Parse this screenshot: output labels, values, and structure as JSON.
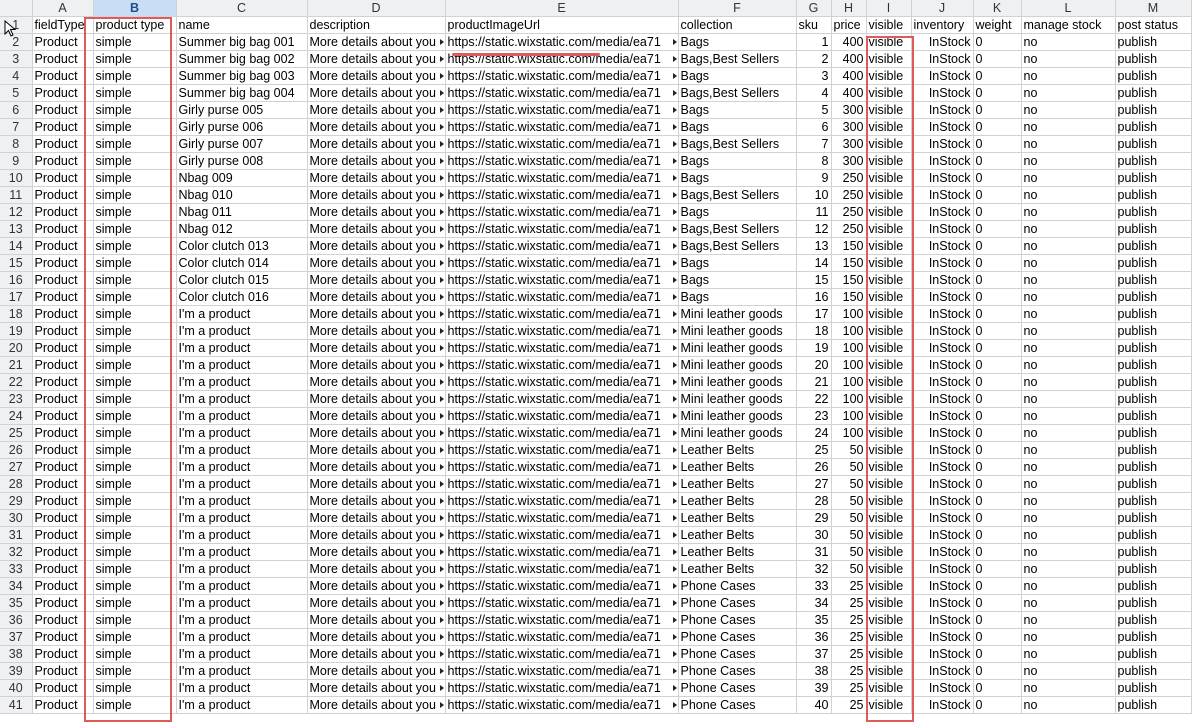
{
  "columns": [
    "",
    "A",
    "B",
    "C",
    "D",
    "E",
    "F",
    "G",
    "H",
    "I",
    "J",
    "K",
    "L",
    "M"
  ],
  "selected_column": "B",
  "header_row": {
    "row": "1",
    "cells": [
      "fieldType",
      "product type",
      "name",
      "description",
      "productImageUrl",
      "collection",
      "sku",
      "price",
      "visible",
      "inventory",
      "weight",
      "manage stock",
      "post status"
    ]
  },
  "rows": [
    {
      "n": "2",
      "cells": [
        "Product",
        "simple",
        "Summer big bag 001",
        "More details about you",
        "https://static.wixstatic.com/media/ea71",
        "Bags",
        "1",
        "400",
        "visible",
        "InStock",
        "0",
        "no",
        "publish"
      ]
    },
    {
      "n": "3",
      "cells": [
        "Product",
        "simple",
        "Summer big bag 002",
        "More details about you",
        "https://static.wixstatic.com/media/ea71",
        "Bags,Best Sellers",
        "2",
        "400",
        "visible",
        "InStock",
        "0",
        "no",
        "publish"
      ]
    },
    {
      "n": "4",
      "cells": [
        "Product",
        "simple",
        "Summer big bag 003",
        "More details about you",
        "https://static.wixstatic.com/media/ea71",
        "Bags",
        "3",
        "400",
        "visible",
        "InStock",
        "0",
        "no",
        "publish"
      ]
    },
    {
      "n": "5",
      "cells": [
        "Product",
        "simple",
        "Summer big bag 004",
        "More details about you",
        "https://static.wixstatic.com/media/ea71",
        "Bags,Best Sellers",
        "4",
        "400",
        "visible",
        "InStock",
        "0",
        "no",
        "publish"
      ]
    },
    {
      "n": "6",
      "cells": [
        "Product",
        "simple",
        "Girly purse 005",
        "More details about you",
        "https://static.wixstatic.com/media/ea71",
        "Bags",
        "5",
        "300",
        "visible",
        "InStock",
        "0",
        "no",
        "publish"
      ]
    },
    {
      "n": "7",
      "cells": [
        "Product",
        "simple",
        "Girly purse 006",
        "More details about you",
        "https://static.wixstatic.com/media/ea71",
        "Bags",
        "6",
        "300",
        "visible",
        "InStock",
        "0",
        "no",
        "publish"
      ]
    },
    {
      "n": "8",
      "cells": [
        "Product",
        "simple",
        "Girly purse 007",
        "More details about you",
        "https://static.wixstatic.com/media/ea71",
        "Bags,Best Sellers",
        "7",
        "300",
        "visible",
        "InStock",
        "0",
        "no",
        "publish"
      ]
    },
    {
      "n": "9",
      "cells": [
        "Product",
        "simple",
        "Girly purse 008",
        "More details about you",
        "https://static.wixstatic.com/media/ea71",
        "Bags",
        "8",
        "300",
        "visible",
        "InStock",
        "0",
        "no",
        "publish"
      ]
    },
    {
      "n": "10",
      "cells": [
        "Product",
        "simple",
        "Nbag 009",
        "More details about you",
        "https://static.wixstatic.com/media/ea71",
        "Bags",
        "9",
        "250",
        "visible",
        "InStock",
        "0",
        "no",
        "publish"
      ]
    },
    {
      "n": "11",
      "cells": [
        "Product",
        "simple",
        "Nbag 010",
        "More details about you",
        "https://static.wixstatic.com/media/ea71",
        "Bags,Best Sellers",
        "10",
        "250",
        "visible",
        "InStock",
        "0",
        "no",
        "publish"
      ]
    },
    {
      "n": "12",
      "cells": [
        "Product",
        "simple",
        "Nbag 011",
        "More details about you",
        "https://static.wixstatic.com/media/ea71",
        "Bags",
        "11",
        "250",
        "visible",
        "InStock",
        "0",
        "no",
        "publish"
      ]
    },
    {
      "n": "13",
      "cells": [
        "Product",
        "simple",
        "Nbag 012",
        "More details about you",
        "https://static.wixstatic.com/media/ea71",
        "Bags,Best Sellers",
        "12",
        "250",
        "visible",
        "InStock",
        "0",
        "no",
        "publish"
      ]
    },
    {
      "n": "14",
      "cells": [
        "Product",
        "simple",
        "Color clutch 013",
        "More details about you",
        "https://static.wixstatic.com/media/ea71",
        "Bags,Best Sellers",
        "13",
        "150",
        "visible",
        "InStock",
        "0",
        "no",
        "publish"
      ]
    },
    {
      "n": "15",
      "cells": [
        "Product",
        "simple",
        "Color clutch 014",
        "More details about you",
        "https://static.wixstatic.com/media/ea71",
        "Bags",
        "14",
        "150",
        "visible",
        "InStock",
        "0",
        "no",
        "publish"
      ]
    },
    {
      "n": "16",
      "cells": [
        "Product",
        "simple",
        "Color clutch 015",
        "More details about you",
        "https://static.wixstatic.com/media/ea71",
        "Bags",
        "15",
        "150",
        "visible",
        "InStock",
        "0",
        "no",
        "publish"
      ]
    },
    {
      "n": "17",
      "cells": [
        "Product",
        "simple",
        "Color clutch 016",
        "More details about you",
        "https://static.wixstatic.com/media/ea71",
        "Bags",
        "16",
        "150",
        "visible",
        "InStock",
        "0",
        "no",
        "publish"
      ]
    },
    {
      "n": "18",
      "cells": [
        "Product",
        "simple",
        "I'm a product",
        "More details about you",
        "https://static.wixstatic.com/media/ea71",
        "Mini leather goods",
        "17",
        "100",
        "visible",
        "InStock",
        "0",
        "no",
        "publish"
      ]
    },
    {
      "n": "19",
      "cells": [
        "Product",
        "simple",
        "I'm a product",
        "More details about you",
        "https://static.wixstatic.com/media/ea71",
        "Mini leather goods",
        "18",
        "100",
        "visible",
        "InStock",
        "0",
        "no",
        "publish"
      ]
    },
    {
      "n": "20",
      "cells": [
        "Product",
        "simple",
        "I'm a product",
        "More details about you",
        "https://static.wixstatic.com/media/ea71",
        "Mini leather goods",
        "19",
        "100",
        "visible",
        "InStock",
        "0",
        "no",
        "publish"
      ]
    },
    {
      "n": "21",
      "cells": [
        "Product",
        "simple",
        "I'm a product",
        "More details about you",
        "https://static.wixstatic.com/media/ea71",
        "Mini leather goods",
        "20",
        "100",
        "visible",
        "InStock",
        "0",
        "no",
        "publish"
      ]
    },
    {
      "n": "22",
      "cells": [
        "Product",
        "simple",
        "I'm a product",
        "More details about you",
        "https://static.wixstatic.com/media/ea71",
        "Mini leather goods",
        "21",
        "100",
        "visible",
        "InStock",
        "0",
        "no",
        "publish"
      ]
    },
    {
      "n": "23",
      "cells": [
        "Product",
        "simple",
        "I'm a product",
        "More details about you",
        "https://static.wixstatic.com/media/ea71",
        "Mini leather goods",
        "22",
        "100",
        "visible",
        "InStock",
        "0",
        "no",
        "publish"
      ]
    },
    {
      "n": "24",
      "cells": [
        "Product",
        "simple",
        "I'm a product",
        "More details about you",
        "https://static.wixstatic.com/media/ea71",
        "Mini leather goods",
        "23",
        "100",
        "visible",
        "InStock",
        "0",
        "no",
        "publish"
      ]
    },
    {
      "n": "25",
      "cells": [
        "Product",
        "simple",
        "I'm a product",
        "More details about you",
        "https://static.wixstatic.com/media/ea71",
        "Mini leather goods",
        "24",
        "100",
        "visible",
        "InStock",
        "0",
        "no",
        "publish"
      ]
    },
    {
      "n": "26",
      "cells": [
        "Product",
        "simple",
        "I'm a product",
        "More details about you",
        "https://static.wixstatic.com/media/ea71",
        "Leather Belts",
        "25",
        "50",
        "visible",
        "InStock",
        "0",
        "no",
        "publish"
      ]
    },
    {
      "n": "27",
      "cells": [
        "Product",
        "simple",
        "I'm a product",
        "More details about you",
        "https://static.wixstatic.com/media/ea71",
        "Leather Belts",
        "26",
        "50",
        "visible",
        "InStock",
        "0",
        "no",
        "publish"
      ]
    },
    {
      "n": "28",
      "cells": [
        "Product",
        "simple",
        "I'm a product",
        "More details about you",
        "https://static.wixstatic.com/media/ea71",
        "Leather Belts",
        "27",
        "50",
        "visible",
        "InStock",
        "0",
        "no",
        "publish"
      ]
    },
    {
      "n": "29",
      "cells": [
        "Product",
        "simple",
        "I'm a product",
        "More details about you",
        "https://static.wixstatic.com/media/ea71",
        "Leather Belts",
        "28",
        "50",
        "visible",
        "InStock",
        "0",
        "no",
        "publish"
      ]
    },
    {
      "n": "30",
      "cells": [
        "Product",
        "simple",
        "I'm a product",
        "More details about you",
        "https://static.wixstatic.com/media/ea71",
        "Leather Belts",
        "29",
        "50",
        "visible",
        "InStock",
        "0",
        "no",
        "publish"
      ]
    },
    {
      "n": "31",
      "cells": [
        "Product",
        "simple",
        "I'm a product",
        "More details about you",
        "https://static.wixstatic.com/media/ea71",
        "Leather Belts",
        "30",
        "50",
        "visible",
        "InStock",
        "0",
        "no",
        "publish"
      ]
    },
    {
      "n": "32",
      "cells": [
        "Product",
        "simple",
        "I'm a product",
        "More details about you",
        "https://static.wixstatic.com/media/ea71",
        "Leather Belts",
        "31",
        "50",
        "visible",
        "InStock",
        "0",
        "no",
        "publish"
      ]
    },
    {
      "n": "33",
      "cells": [
        "Product",
        "simple",
        "I'm a product",
        "More details about you",
        "https://static.wixstatic.com/media/ea71",
        "Leather Belts",
        "32",
        "50",
        "visible",
        "InStock",
        "0",
        "no",
        "publish"
      ]
    },
    {
      "n": "34",
      "cells": [
        "Product",
        "simple",
        "I'm a product",
        "More details about you",
        "https://static.wixstatic.com/media/ea71",
        "Phone Cases",
        "33",
        "25",
        "visible",
        "InStock",
        "0",
        "no",
        "publish"
      ]
    },
    {
      "n": "35",
      "cells": [
        "Product",
        "simple",
        "I'm a product",
        "More details about you",
        "https://static.wixstatic.com/media/ea71",
        "Phone Cases",
        "34",
        "25",
        "visible",
        "InStock",
        "0",
        "no",
        "publish"
      ]
    },
    {
      "n": "36",
      "cells": [
        "Product",
        "simple",
        "I'm a product",
        "More details about you",
        "https://static.wixstatic.com/media/ea71",
        "Phone Cases",
        "35",
        "25",
        "visible",
        "InStock",
        "0",
        "no",
        "publish"
      ]
    },
    {
      "n": "37",
      "cells": [
        "Product",
        "simple",
        "I'm a product",
        "More details about you",
        "https://static.wixstatic.com/media/ea71",
        "Phone Cases",
        "36",
        "25",
        "visible",
        "InStock",
        "0",
        "no",
        "publish"
      ]
    },
    {
      "n": "38",
      "cells": [
        "Product",
        "simple",
        "I'm a product",
        "More details about you",
        "https://static.wixstatic.com/media/ea71",
        "Phone Cases",
        "37",
        "25",
        "visible",
        "InStock",
        "0",
        "no",
        "publish"
      ]
    },
    {
      "n": "39",
      "cells": [
        "Product",
        "simple",
        "I'm a product",
        "More details about you",
        "https://static.wixstatic.com/media/ea71",
        "Phone Cases",
        "38",
        "25",
        "visible",
        "InStock",
        "0",
        "no",
        "publish"
      ]
    },
    {
      "n": "40",
      "cells": [
        "Product",
        "simple",
        "I'm a product",
        "More details about you",
        "https://static.wixstatic.com/media/ea71",
        "Phone Cases",
        "39",
        "25",
        "visible",
        "InStock",
        "0",
        "no",
        "publish"
      ]
    },
    {
      "n": "41",
      "cells": [
        "Product",
        "simple",
        "I'm a product",
        "More details about you",
        "https://static.wixstatic.com/media/ea71",
        "Phone Cases",
        "40",
        "25",
        "visible",
        "InStock",
        "0",
        "no",
        "publish"
      ]
    }
  ],
  "colors": {
    "highlight": "#e05a5a",
    "selected_header": "#c9def5",
    "header_bg": "#eef0f2",
    "grid": "#cfd3d8"
  },
  "icons": {
    "cursor": "mouse-pointer-icon"
  }
}
